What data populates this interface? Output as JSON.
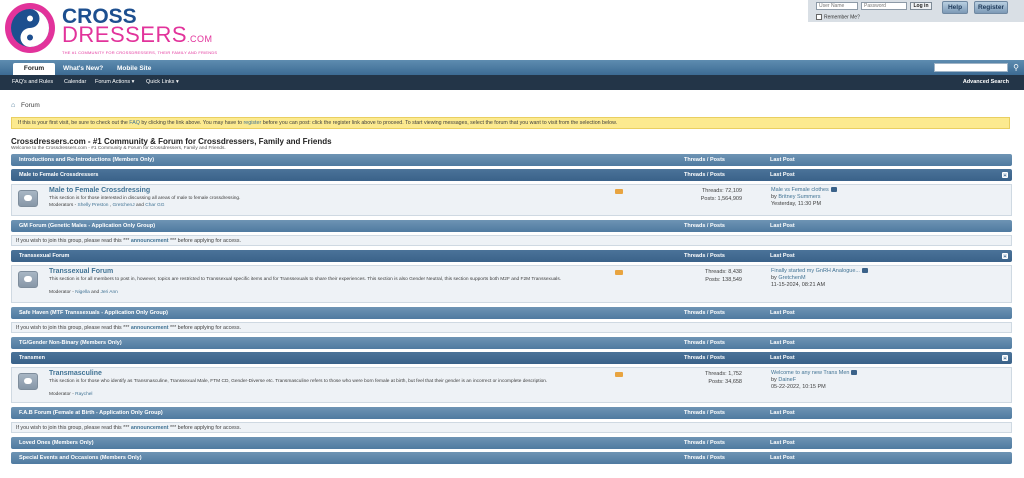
{
  "header": {
    "brand_top": "CROSS",
    "brand_bottom": "DRESSERS",
    "brand_suffix": ".COM",
    "tagline": "THE #1 COMMUNITY FOR CROSSDRESSERS, THEIR FAMILY AND FRIENDS",
    "login": {
      "username_placeholder": "User Name",
      "password_placeholder": "Password",
      "login_label": "Log in",
      "remember_label": "Remember Me?",
      "help_label": "Help",
      "register_label": "Register"
    }
  },
  "navbar": {
    "tabs": [
      "Forum",
      "What's New?",
      "Mobile Site"
    ],
    "sub": {
      "faq": "FAQ's and Rules",
      "calendar": "Calendar",
      "actions": "Forum Actions ▾",
      "quick": "Quick Links ▾",
      "advanced": "Advanced Search"
    }
  },
  "breadcrumb": "Forum",
  "notice": {
    "p1": "If this is your first visit, be sure to check out the ",
    "faq": "FAQ",
    "p2": " by clicking the link above. You may have to ",
    "register": "register",
    "p3": " before you can post: click the register link above to proceed. To start viewing messages, select the forum that you want to visit from the selection below."
  },
  "site": {
    "title": "Crossdressers.com - #1 Community & Forum for Crossdressers, Family and Friends",
    "subtitle": "Welcome to the Crossdressers.com - #1 Community & Forum for Crossdressers, Family and Friends."
  },
  "columns": {
    "threads_posts": "Threads / Posts",
    "last_post": "Last Post"
  },
  "group_note": {
    "p1": "If you wish to join this group, please read this *** ",
    "link": "announcement",
    "p2": " *** before applying for access."
  },
  "categories": {
    "intro": "Introductions and Re-Introductions (Members Only)",
    "mtf": "Male to Female Crossdressers",
    "gm": "GM Forum (Genetic Males - Application Only Group)",
    "ts": "Transsexual Forum",
    "safe": "Safe Haven (MTF Transsexuals - Application Only Group)",
    "tg": "TG/Gender Non-Binary (Members Only)",
    "transmen": "Transmen",
    "fab": "F.A.B Forum (Female at Birth - Application Only Group)",
    "loved": "Loved Ones (Members Only)",
    "special": "Special Events and Occasions (Members Only)"
  },
  "forums": {
    "mtf": {
      "title": "Male to Female Crossdressing",
      "desc": "This section is for those interested in discussing all areas of male to female crossdressing.",
      "mods_label": "Moderators - ",
      "mod1": "Shelly Preston",
      "sep1": " , ",
      "mod2": "GretchenJ",
      "sep2": " and ",
      "mod3": "Char GG",
      "threads": "Threads: 72,109",
      "posts": "Posts: 1,564,909",
      "last_title": "Male vs Female clothes",
      "last_by": "by ",
      "last_user": "Britney Summers",
      "last_date": "Yesterday, 11:30 PM"
    },
    "ts": {
      "title": "Transsexual Forum",
      "desc": "This section is for all members to post in, however, topics are restricted to Transsexual specific items and for Transsexuals to share their experiences. This section is also Gender Neutral, this section supports both M2F and F2M Transsexuals.",
      "mods_label": "Moderator - ",
      "mod1": "Nigella",
      "sep1": " and ",
      "mod2": "Jeri Ann",
      "threads": "Threads: 8,438",
      "posts": "Posts: 138,549",
      "last_title": "Finally started my GnRH Analogue...",
      "last_by": "by ",
      "last_user": "GretchenM",
      "last_date": "11-15-2024, 08:21 AM"
    },
    "transmen": {
      "title": "Transmasculine",
      "desc": "This section is for those who identify as Transmasculine, Transsexual Male, FTM CD, Gender-Diverse etc. Transmasculine refers to those who were born female at birth, but feel that their gender is an incorrect or incomplete description.",
      "mods_label": "Moderator - ",
      "mod1": "Raychel",
      "threads": "Threads: 1,752",
      "posts": "Posts: 34,658",
      "last_title": "Welcome to any new Trans Men",
      "last_by": "by ",
      "last_user": "DaineF",
      "last_date": "05-22-2022, 10:15 PM"
    }
  },
  "colors": {
    "accent": "#417394",
    "navbar": "#4f7aa0",
    "notice": "#fcea8f",
    "brand_pink": "#e2339b",
    "brand_blue": "#1d4f8f"
  }
}
